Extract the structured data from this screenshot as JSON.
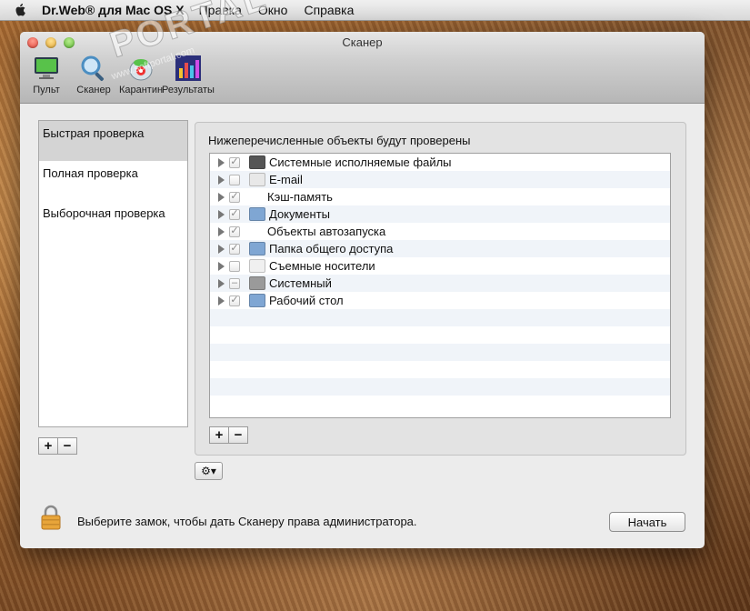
{
  "menubar": {
    "app_name": "Dr.Web® для Mac OS X",
    "items": [
      "Правка",
      "Окно",
      "Справка"
    ]
  },
  "window": {
    "title": "Сканер",
    "toolbar": [
      {
        "label": "Пульт",
        "icon": "monitor-icon"
      },
      {
        "label": "Сканер",
        "icon": "magnifier-icon"
      },
      {
        "label": "Карантин",
        "icon": "quarantine-icon"
      },
      {
        "label": "Результаты",
        "icon": "chart-icon"
      }
    ]
  },
  "watermark": {
    "text": "PORTAL",
    "sub": "www.softportal.com"
  },
  "scan_types": [
    {
      "label": "Быстрая проверка",
      "selected": true
    },
    {
      "label": "Полная проверка",
      "selected": false
    },
    {
      "label": "Выборочная проверка",
      "selected": false
    }
  ],
  "objects_panel": {
    "heading": "Нижеперечисленные объекты будут проверены",
    "rows": [
      {
        "label": "Системные исполняемые файлы",
        "state": "checked",
        "icon": "drive-icon",
        "icon_color": "#555555"
      },
      {
        "label": "E-mail",
        "state": "unchecked",
        "icon": "mail-icon",
        "icon_color": "#e8e8e8"
      },
      {
        "label": "Кэш-память",
        "state": "checked",
        "icon": "",
        "icon_color": ""
      },
      {
        "label": "Документы",
        "state": "checked",
        "icon": "folder-icon",
        "icon_color": "#7fa6d3"
      },
      {
        "label": "Объекты автозапуска",
        "state": "checked",
        "icon": "",
        "icon_color": ""
      },
      {
        "label": "Папка общего доступа",
        "state": "checked",
        "icon": "shared-folder-icon",
        "icon_color": "#7fa6d3"
      },
      {
        "label": "Съемные носители",
        "state": "unchecked",
        "icon": "removable-icon",
        "icon_color": "#f0f0f0"
      },
      {
        "label": "Системный",
        "state": "mixed",
        "icon": "hdd-icon",
        "icon_color": "#9a9a9a"
      },
      {
        "label": "Рабочий стол",
        "state": "checked",
        "icon": "desktop-folder-icon",
        "icon_color": "#7fa6d3"
      }
    ],
    "empty_rows": 6
  },
  "buttons": {
    "add": "+",
    "remove": "−",
    "gear_menu": "⚙▾",
    "start": "Начать"
  },
  "status_text": "Выберите замок, чтобы дать Сканеру права администратора."
}
